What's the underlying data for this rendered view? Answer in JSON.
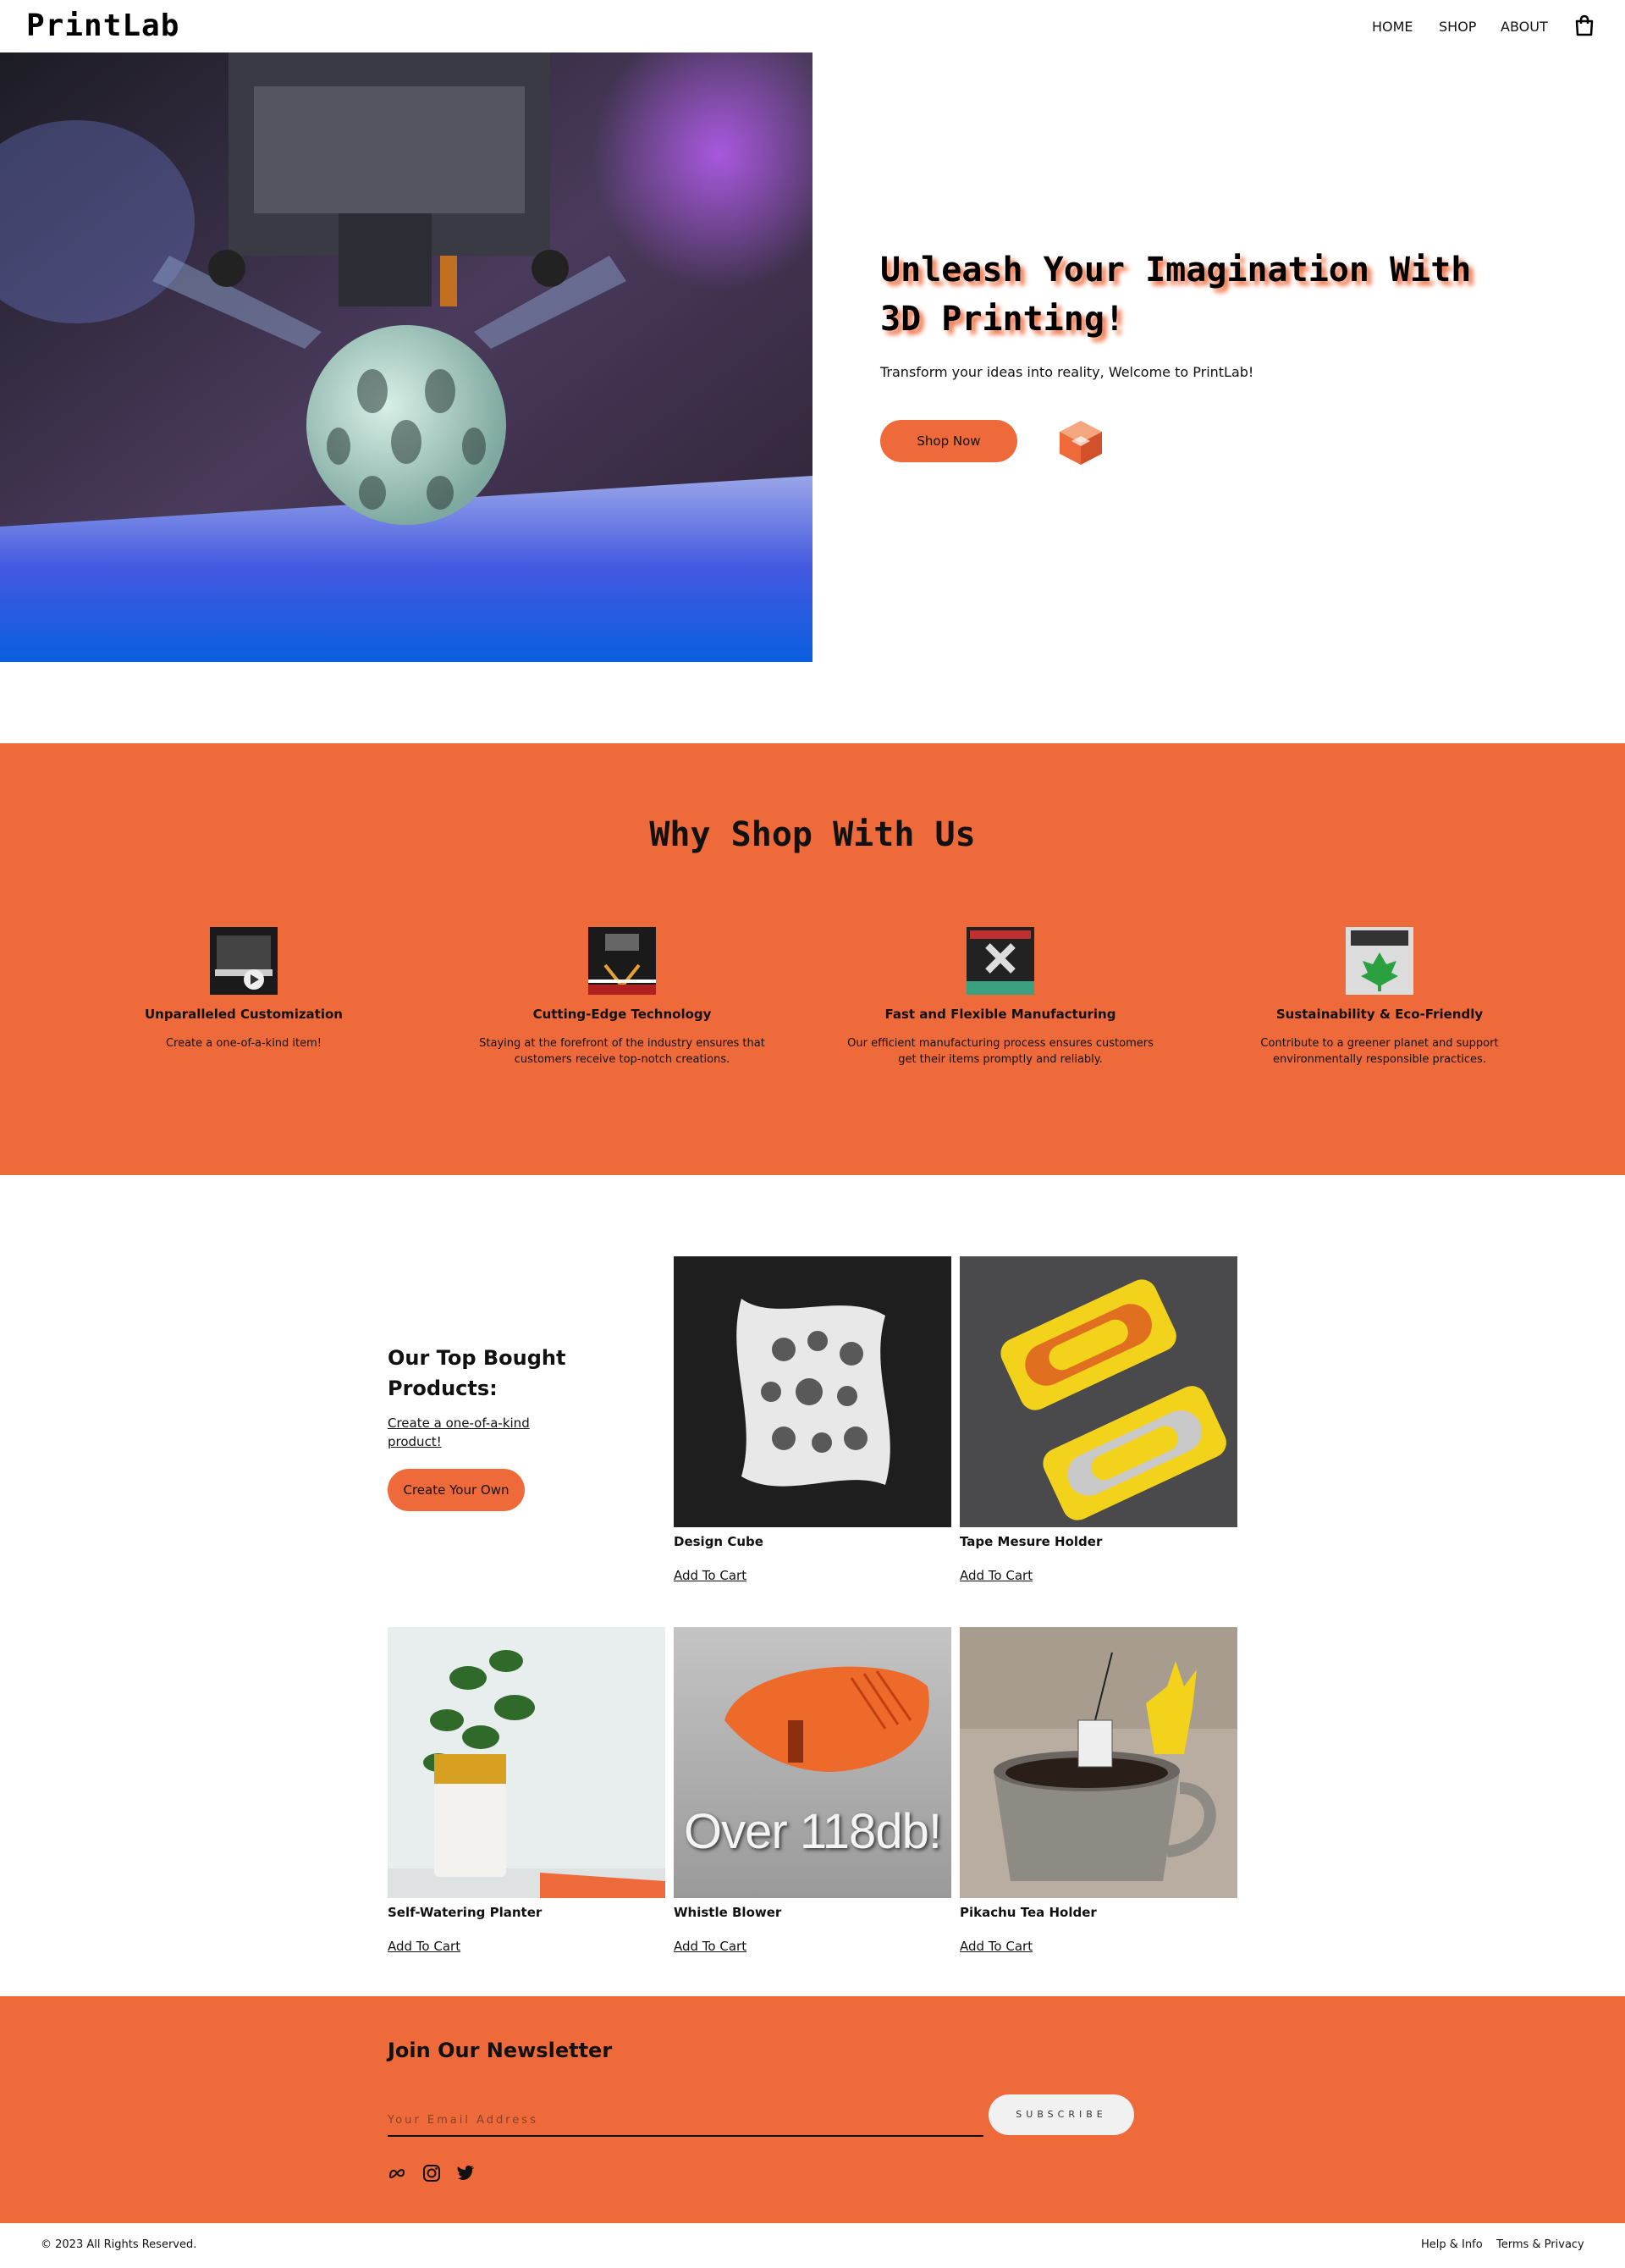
{
  "header": {
    "logo": "PrintLab",
    "nav": [
      {
        "label": "HOME"
      },
      {
        "label": "SHOP"
      },
      {
        "label": "ABOUT"
      }
    ]
  },
  "hero": {
    "title": "Unleash Your Imagination With 3D Printing!",
    "subtitle": "Transform your ideas into reality, Welcome to PrintLab!",
    "button": "Shop Now"
  },
  "why": {
    "title": "Why Shop With Us",
    "features": [
      {
        "title": "Unparalleled Customization",
        "desc": "Create a one-of-a-kind item!"
      },
      {
        "title": "Cutting-Edge Technology",
        "desc": "Staying at the forefront of the industry ensures that customers receive top-notch creations."
      },
      {
        "title": "Fast and Flexible Manufacturing",
        "desc": "Our efficient manufacturing process ensures customers get their items promptly and reliably."
      },
      {
        "title": "Sustainability & Eco-Friendly",
        "desc": "Contribute to a greener planet and support environmentally responsible practices."
      }
    ]
  },
  "products": {
    "title": "Our Top Bought Products:",
    "link": "Create a one-of-a-kind product!",
    "button": "Create Your Own",
    "cart_label": "Add To Cart",
    "items": [
      {
        "name": "Design Cube",
        "overlay": ""
      },
      {
        "name": "Tape Mesure Holder",
        "overlay": ""
      },
      {
        "name": "Self-Watering Planter",
        "overlay": ""
      },
      {
        "name": "Whistle Blower",
        "overlay": "Over 118db!"
      },
      {
        "name": "Pikachu Tea Holder",
        "overlay": ""
      }
    ]
  },
  "newsletter": {
    "title": "Join Our Newsletter",
    "placeholder": "Your Email Address",
    "button": "SUBSCRIBE",
    "social": [
      "meta-icon",
      "instagram-icon",
      "twitter-icon"
    ]
  },
  "footer": {
    "copyright": "© 2023 All Rights Reserved.",
    "links": [
      "Help & Info",
      "Terms & Privacy"
    ]
  },
  "colors": {
    "accent": "#ee6a3b",
    "text": "#111111",
    "background": "#ffffff"
  }
}
